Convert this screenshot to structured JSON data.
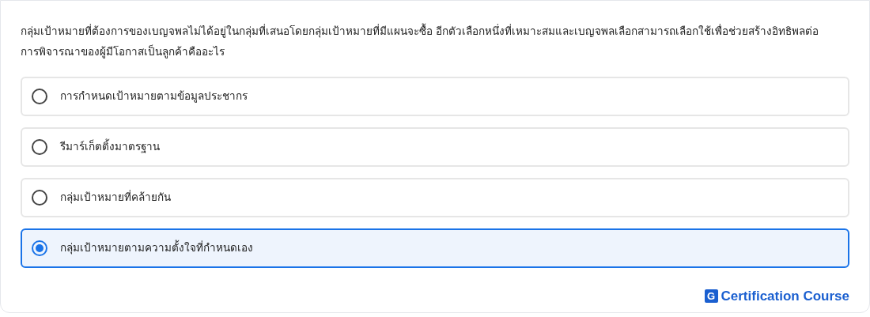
{
  "question": "กลุ่มเป้าหมายที่ต้องการของเบญจพลไม่ได้อยู่ในกลุ่มที่เสนอโดยกลุ่มเป้าหมายที่มีแผนจะซื้อ อีกตัวเลือกหนึ่งที่เหมาะสมและเบญจพลเลือกสามารถเลือกใช้เพื่อช่วยสร้างอิทธิพลต่อการพิจารณาของผู้มีโอกาสเป็นลูกค้าคืออะไร",
  "options": [
    {
      "label": "การกำหนดเป้าหมายตามข้อมูลประชากร",
      "selected": false
    },
    {
      "label": "รีมาร์เก็ตติ้งมาตรฐาน",
      "selected": false
    },
    {
      "label": "กลุ่มเป้าหมายที่คล้ายกัน",
      "selected": false
    },
    {
      "label": "กลุ่มเป้าหมายตามความตั้งใจที่กำหนดเอง",
      "selected": true
    }
  ],
  "brand": {
    "mark": "G",
    "name": "Certification Course"
  }
}
